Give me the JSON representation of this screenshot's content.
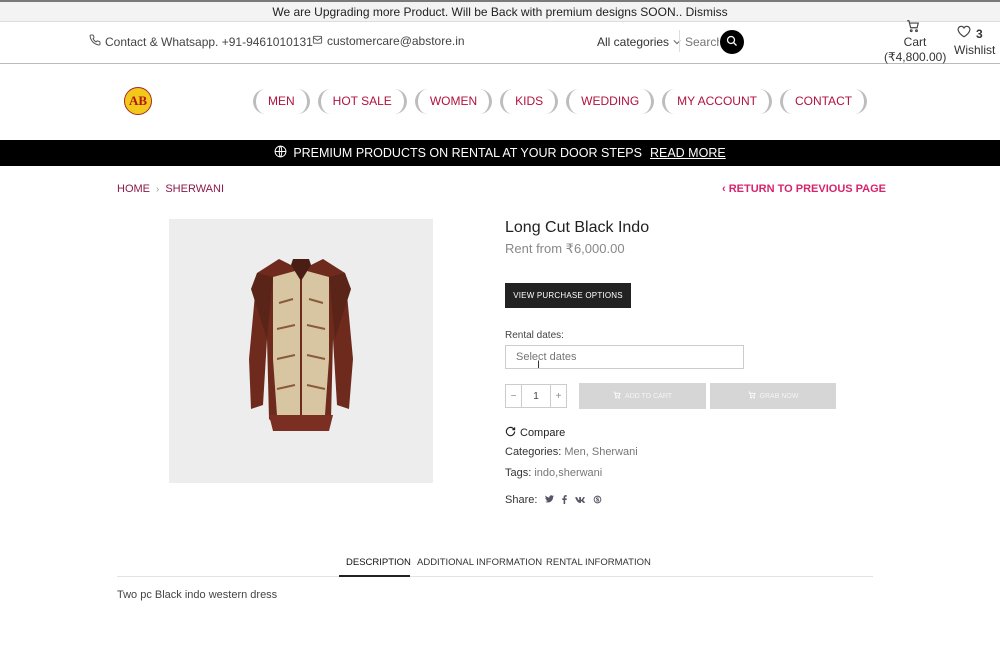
{
  "notice": {
    "text": "We are Upgrading more Product. Will be Back with premium designs SOON.. Dismiss"
  },
  "topbar": {
    "contact_text": "Contact & Whatsapp. +91-9461010131",
    "email_text": "customercare@abstore.in",
    "category_select": "All categories",
    "search_placeholder": "Search",
    "cart_label": "Cart",
    "cart_total": "(₹4,800.00)",
    "wishlist_count": "3",
    "wishlist_label": "Wishlist"
  },
  "logo": {
    "text": "AB"
  },
  "nav": [
    "MEN",
    "HOT SALE",
    "WOMEN",
    "KIDS",
    "WEDDING",
    "MY ACCOUNT",
    "CONTACT"
  ],
  "promo": {
    "text": "PREMIUM PRODUCTS ON RENTAL AT YOUR DOOR STEPS",
    "link": "READ MORE"
  },
  "breadcrumb": {
    "home": "HOME",
    "current": "SHERWANI"
  },
  "return_link": "RETURN TO PREVIOUS PAGE",
  "product": {
    "title": "Long Cut Black Indo",
    "price": "Rent from ₹6,000.00",
    "purchase_button": "VIEW PURCHASE OPTIONS",
    "rental_dates_label": "Rental dates:",
    "dates_placeholder": "Select dates",
    "quantity": "1",
    "add_to_cart": "ADD TO CART",
    "grab_now": "GRAB NOW",
    "compare": "Compare",
    "categories_label": "Categories:",
    "categories": [
      "Men",
      "Sherwani"
    ],
    "tags_label": "Tags:",
    "tags": "indo,sherwani",
    "share_label": "Share:"
  },
  "tabs": [
    "DESCRIPTION",
    "ADDITIONAL INFORMATION",
    "RENTAL INFORMATION"
  ],
  "description": "Two pc Black indo western dress",
  "colors": {
    "accent": "#b2123d",
    "link": "#d6246e",
    "dark": "#222222"
  }
}
